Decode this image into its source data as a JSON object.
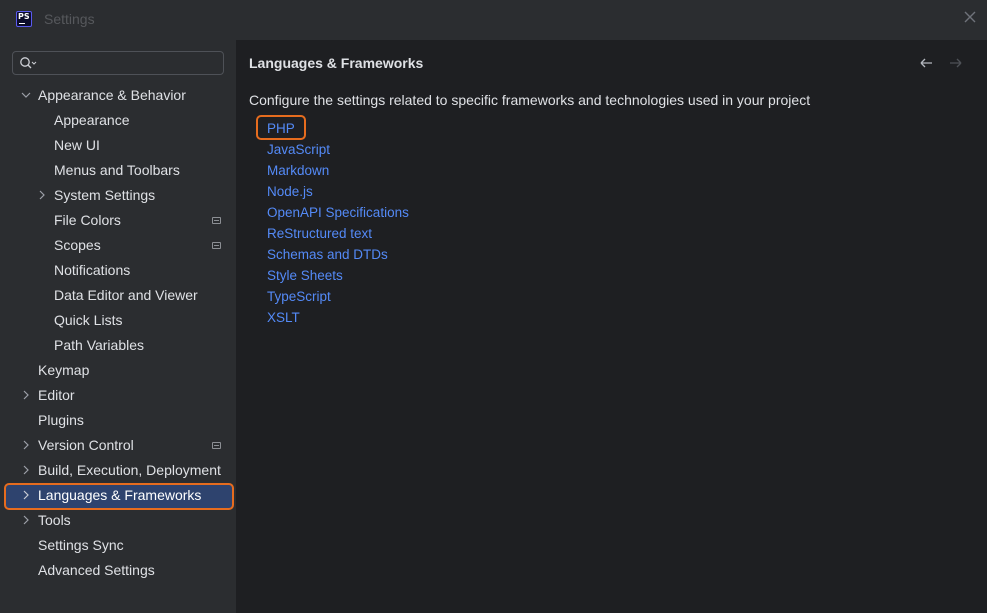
{
  "window": {
    "title": "Settings",
    "app_icon": "PS"
  },
  "search": {
    "placeholder": "",
    "value": ""
  },
  "sidebar": {
    "items": [
      {
        "label": "Appearance & Behavior",
        "expanded": true
      },
      {
        "label": "Appearance"
      },
      {
        "label": "New UI"
      },
      {
        "label": "Menus and Toolbars"
      },
      {
        "label": "System Settings",
        "expandable": true
      },
      {
        "label": "File Colors",
        "badge": true
      },
      {
        "label": "Scopes",
        "badge": true
      },
      {
        "label": "Notifications"
      },
      {
        "label": "Data Editor and Viewer"
      },
      {
        "label": "Quick Lists"
      },
      {
        "label": "Path Variables"
      },
      {
        "label": "Keymap"
      },
      {
        "label": "Editor",
        "expandable": true
      },
      {
        "label": "Plugins"
      },
      {
        "label": "Version Control",
        "expandable": true,
        "badge": true
      },
      {
        "label": "Build, Execution, Deployment",
        "expandable": true
      },
      {
        "label": "Languages & Frameworks",
        "expandable": true,
        "selected": true
      },
      {
        "label": "Tools",
        "expandable": true
      },
      {
        "label": "Settings Sync"
      },
      {
        "label": "Advanced Settings"
      }
    ]
  },
  "main": {
    "title": "Languages & Frameworks",
    "description": "Configure the settings related to specific frameworks and technologies used in your project",
    "links": [
      "PHP",
      "JavaScript",
      "Markdown",
      "Node.js",
      "OpenAPI Specifications",
      "ReStructured text",
      "Schemas and DTDs",
      "Style Sheets",
      "TypeScript",
      "XSLT"
    ]
  },
  "colors": {
    "selection": "#2e436e",
    "highlight": "#e66c1e",
    "link": "#548af7"
  }
}
